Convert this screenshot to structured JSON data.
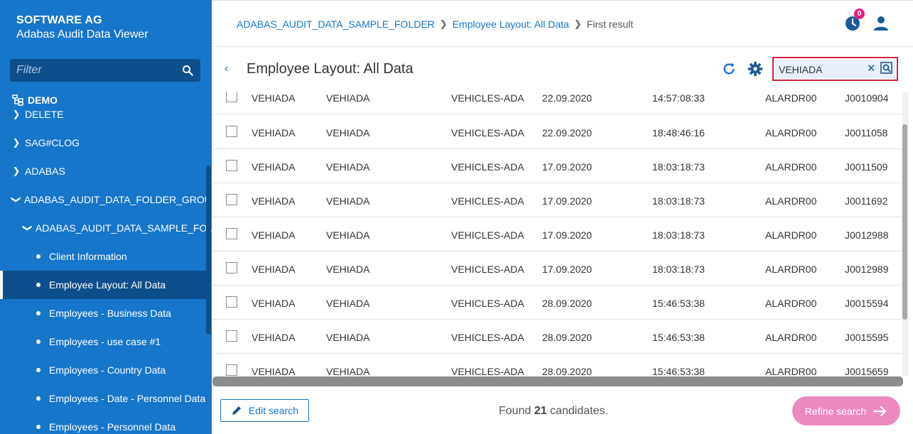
{
  "sidebar": {
    "company": "SOFTWARE AG",
    "product": "Adabas Audit Data Viewer",
    "filter_placeholder": "Filter",
    "root": "DEMO",
    "items": [
      {
        "label": "DELETE",
        "kind": "folder",
        "expanded": false
      },
      {
        "label": "SAG#CLOG",
        "kind": "folder",
        "expanded": false
      },
      {
        "label": "ADABAS",
        "kind": "folder",
        "expanded": false
      },
      {
        "label": "ADABAS_AUDIT_DATA_FOLDER_GROUP",
        "kind": "folder",
        "expanded": true
      },
      {
        "label": "ADABAS_AUDIT_DATA_SAMPLE_FO...",
        "kind": "folder",
        "expanded": true
      },
      {
        "label": "Client Information",
        "kind": "leaf"
      },
      {
        "label": "Employee Layout: All Data",
        "kind": "leaf",
        "selected": true
      },
      {
        "label": "Employees - Business Data",
        "kind": "leaf"
      },
      {
        "label": "Employees - use case #1",
        "kind": "leaf"
      },
      {
        "label": "Employees - Country Data",
        "kind": "leaf"
      },
      {
        "label": "Employees - Date - Personnel Data",
        "kind": "leaf"
      },
      {
        "label": "Employees - Personnel Data",
        "kind": "leaf"
      }
    ]
  },
  "breadcrumb": {
    "folder": "ADABAS_AUDIT_DATA_SAMPLE_FOLDER",
    "layout": "Employee Layout: All Data",
    "current": "First result"
  },
  "header": {
    "notification_count": "0"
  },
  "main": {
    "back": "‹",
    "title": "Employee Layout: All Data",
    "search_value": "VEHIADA",
    "clear": "✕"
  },
  "rows": [
    [
      "VEHIADA",
      "VEHIADA",
      "VEHICLES-ADA",
      "22.09.2020",
      "14:57:08:33",
      "ALARDR00",
      "J0010904"
    ],
    [
      "VEHIADA",
      "VEHIADA",
      "VEHICLES-ADA",
      "22.09.2020",
      "18:48:46:16",
      "ALARDR00",
      "J0011058"
    ],
    [
      "VEHIADA",
      "VEHIADA",
      "VEHICLES-ADA",
      "17.09.2020",
      "18:03:18:73",
      "ALARDR00",
      "J0011509"
    ],
    [
      "VEHIADA",
      "VEHIADA",
      "VEHICLES-ADA",
      "17.09.2020",
      "18:03:18:73",
      "ALARDR00",
      "J0011692"
    ],
    [
      "VEHIADA",
      "VEHIADA",
      "VEHICLES-ADA",
      "17.09.2020",
      "18:03:18:73",
      "ALARDR00",
      "J0012988"
    ],
    [
      "VEHIADA",
      "VEHIADA",
      "VEHICLES-ADA",
      "17.09.2020",
      "18:03:18:73",
      "ALARDR00",
      "J0012989"
    ],
    [
      "VEHIADA",
      "VEHIADA",
      "VEHICLES-ADA",
      "28.09.2020",
      "15:46:53:38",
      "ALARDR00",
      "J0015594"
    ],
    [
      "VEHIADA",
      "VEHIADA",
      "VEHICLES-ADA",
      "28.09.2020",
      "15:46:53:38",
      "ALARDR00",
      "J0015595"
    ],
    [
      "VEHIADA",
      "VEHIADA",
      "VEHICLES-ADA",
      "28.09.2020",
      "15:46:53:38",
      "ALARDR00",
      "J0015659"
    ]
  ],
  "footer": {
    "edit_search": "Edit search",
    "found_prefix": "Found",
    "found_count": "21",
    "found_suffix": "candidates.",
    "refine_search": "Refine search"
  },
  "colors": {
    "sidebar": "#1776c9",
    "sidebar_dark": "#0d4f8c",
    "accent": "#1776c9",
    "badge": "#e0217e",
    "refine_button": "#ec8ac0",
    "search_border": "#d0243e"
  }
}
